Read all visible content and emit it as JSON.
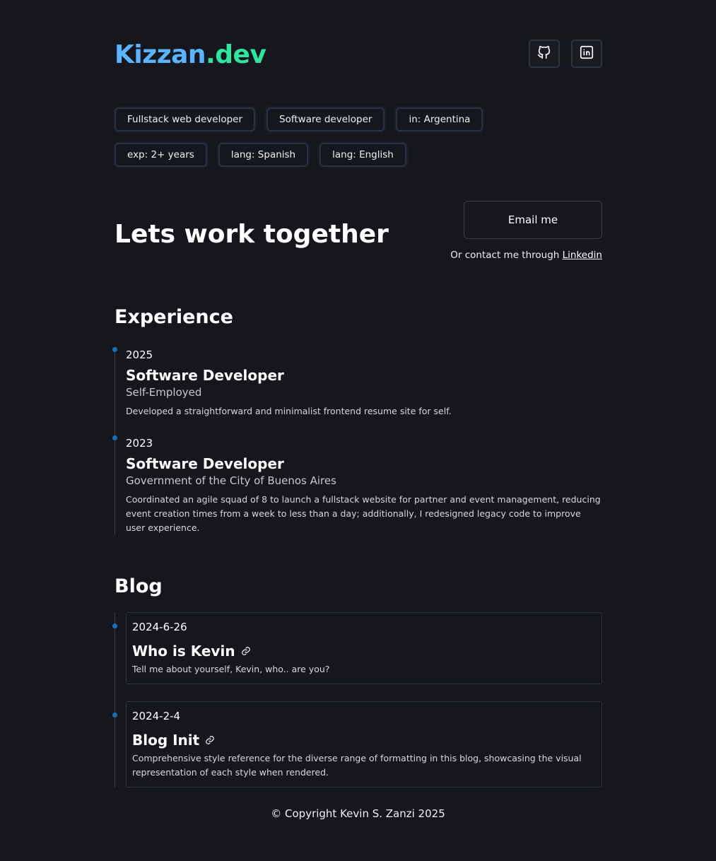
{
  "header": {
    "logo_part1": "Kizzan",
    "logo_part2": ".dev",
    "social": [
      {
        "name": "github-icon"
      },
      {
        "name": "linkedin-icon"
      }
    ]
  },
  "tags": [
    "Fullstack web developer",
    "Software developer",
    "in: Argentina",
    "exp: 2+ years",
    "lang: Spanish",
    "lang: English"
  ],
  "hero": {
    "title": "Lets work together",
    "email_button": "Email me",
    "contact_prefix": "Or contact me through",
    "contact_link": "Linkedin"
  },
  "experience": {
    "title": "Experience",
    "items": [
      {
        "year": "2025",
        "role": "Software Developer",
        "company": "Self-Employed",
        "description": "Developed a straightforward and minimalist frontend resume site for self."
      },
      {
        "year": "2023",
        "role": "Software Developer",
        "company": "Government of the City of Buenos Aires",
        "description": "Coordinated an agile squad of 8 to launch a fullstack website for partner and event management, reducing event creation times from a week to less than a day; additionally, I redesigned legacy code to improve user experience."
      }
    ]
  },
  "blog": {
    "title": "Blog",
    "posts": [
      {
        "date": "2024-6-26",
        "title": "Who is Kevin",
        "description": "Tell me about yourself, Kevin, who.. are you?"
      },
      {
        "date": "2024-2-4",
        "title": "Blog Init",
        "description": "Comprehensive style reference for the diverse range of formatting in this blog, showcasing the visual representation of each style when rendered."
      }
    ]
  },
  "footer": {
    "copyright": "© Copyright Kevin S. Zanzi 2025"
  },
  "colors": {
    "background": "#16171c",
    "logo_blue": "#5ab4ff",
    "logo_green": "#2ee6a0",
    "timeline_dot": "#1673b8"
  }
}
